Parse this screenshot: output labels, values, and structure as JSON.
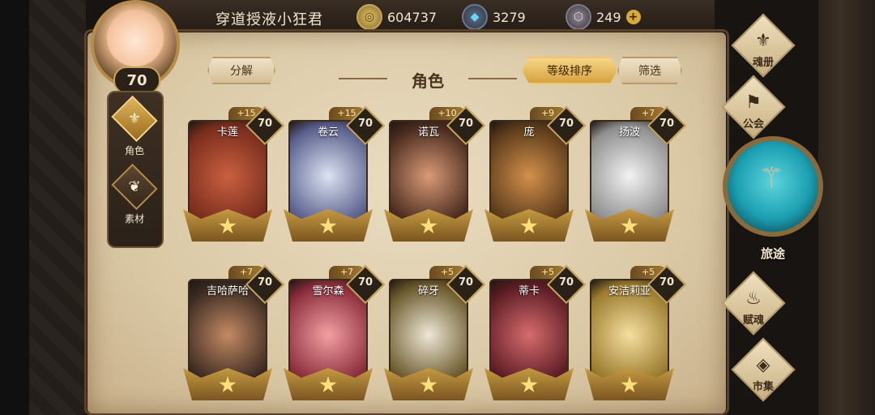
{
  "top_bar": {
    "player_name": "穿道授液小狂君",
    "level": "70",
    "gold": "604737",
    "crystal": "3279",
    "gem": "249",
    "plus": "+"
  },
  "left_tabs": [
    {
      "label": "角色",
      "icon": "helmet-icon",
      "active": true
    },
    {
      "label": "素材",
      "icon": "material-icon",
      "active": false
    }
  ],
  "header": {
    "decompose": "分解",
    "title": "角色",
    "sort": "等级排序",
    "filter": "筛选"
  },
  "heroes": [
    {
      "name": "卡莲",
      "level": "70",
      "plus": "+15",
      "palette": [
        "#7a2d1e",
        "#c9603f"
      ]
    },
    {
      "name": "卷云",
      "level": "70",
      "plus": "+15",
      "palette": [
        "#5a5f8c",
        "#dbe3f2"
      ]
    },
    {
      "name": "诺瓦",
      "level": "70",
      "plus": "+10",
      "palette": [
        "#4a2b1f",
        "#d99a76"
      ]
    },
    {
      "name": "庞",
      "level": "70",
      "plus": "+9",
      "palette": [
        "#5a3a1b",
        "#d3904b"
      ]
    },
    {
      "name": "扬波",
      "level": "70",
      "plus": "+7",
      "palette": [
        "#8f8f8f",
        "#f2f2f2"
      ]
    },
    {
      "name": "吉哈萨哈",
      "level": "70",
      "plus": "+7",
      "palette": [
        "#3b2a22",
        "#c48a63"
      ]
    },
    {
      "name": "雪尔森",
      "level": "70",
      "plus": "+7",
      "palette": [
        "#8a2d3b",
        "#f2a0a2"
      ]
    },
    {
      "name": "碎牙",
      "level": "70",
      "plus": "+5",
      "palette": [
        "#6b5a2d",
        "#eee7d6"
      ]
    },
    {
      "name": "蒂卡",
      "level": "70",
      "plus": "+5",
      "palette": [
        "#5c1c24",
        "#d66c6e"
      ]
    },
    {
      "name": "安洁莉亚",
      "level": "70",
      "plus": "+5",
      "palette": [
        "#9a7a2d",
        "#f5df9f"
      ]
    }
  ],
  "right_menu": {
    "soul_book": "魂册",
    "guild": "公会",
    "journey": "旅途",
    "talent": "赋魂",
    "market": "市集"
  }
}
